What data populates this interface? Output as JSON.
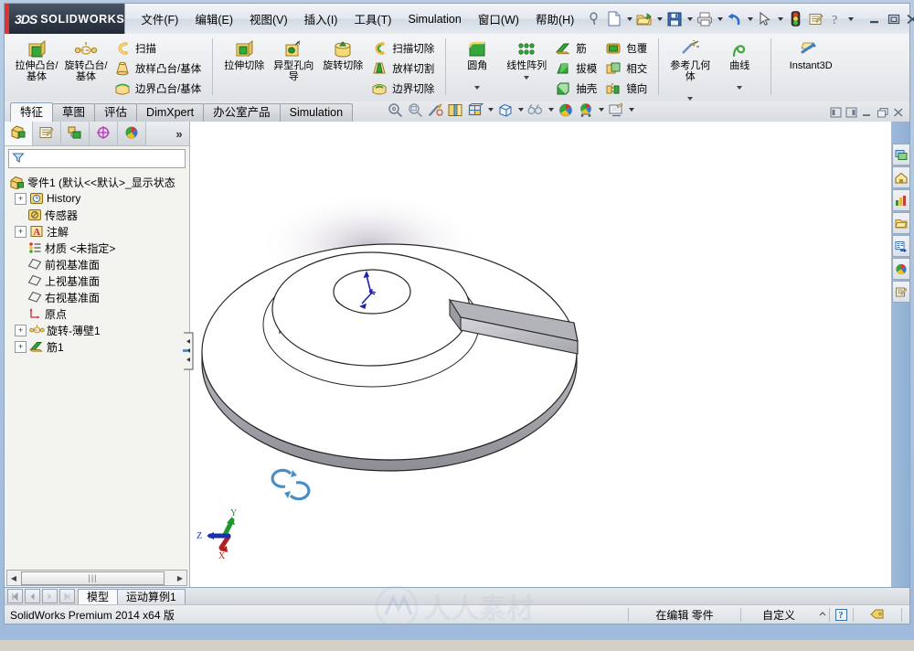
{
  "app": {
    "brand_ds": "3DS",
    "brand_name": "SOLIDWORKS",
    "accent_red": "#d33333",
    "title_dark": "#323c4a"
  },
  "menubar": {
    "items": [
      {
        "label": "文件(F)",
        "name": "menu-file"
      },
      {
        "label": "编辑(E)",
        "name": "menu-edit"
      },
      {
        "label": "视图(V)",
        "name": "menu-view"
      },
      {
        "label": "插入(I)",
        "name": "menu-insert"
      },
      {
        "label": "工具(T)",
        "name": "menu-tools"
      },
      {
        "label": "Simulation",
        "name": "menu-simulation"
      },
      {
        "label": "窗口(W)",
        "name": "menu-window"
      },
      {
        "label": "帮助(H)",
        "name": "menu-help"
      }
    ],
    "icons": [
      "pin-icon",
      "new-document-icon",
      "open-folder-icon",
      "save-icon",
      "print-icon",
      "undo-icon",
      "select-arrow-icon",
      "rebuild-icon",
      "options-icon",
      "help-icon"
    ],
    "window_controls": [
      "minimize",
      "restore",
      "close"
    ]
  },
  "ribbon": {
    "groups": [
      {
        "name": "boss-base-group",
        "big": [
          {
            "label": "拉伸凸台/基体",
            "icon": "extrude-boss-icon",
            "name": "extruded-boss-base"
          },
          {
            "label": "旋转凸台/基体",
            "icon": "revolve-boss-icon",
            "name": "revolved-boss-base"
          }
        ],
        "small": [
          {
            "label": "扫描",
            "icon": "sweep-icon",
            "name": "swept-boss-base"
          },
          {
            "label": "放样凸台/基体",
            "icon": "loft-icon",
            "name": "lofted-boss-base"
          },
          {
            "label": "边界凸台/基体",
            "icon": "boundary-icon",
            "name": "boundary-boss-base"
          }
        ]
      },
      {
        "name": "cut-group",
        "big": [
          {
            "label": "拉伸切除",
            "icon": "extrude-cut-icon",
            "name": "extruded-cut"
          },
          {
            "label": "异型孔向导",
            "icon": "hole-wizard-icon",
            "name": "hole-wizard"
          },
          {
            "label": "旋转切除",
            "icon": "revolve-cut-icon",
            "name": "revolved-cut"
          }
        ],
        "small": [
          {
            "label": "扫描切除",
            "icon": "swept-cut-icon",
            "name": "swept-cut"
          },
          {
            "label": "放样切割",
            "icon": "lofted-cut-icon",
            "name": "lofted-cut"
          },
          {
            "label": "边界切除",
            "icon": "boundary-cut-icon",
            "name": "boundary-cut"
          }
        ]
      },
      {
        "name": "feature-group",
        "big": [
          {
            "label": "圆角",
            "icon": "fillet-icon",
            "name": "fillet",
            "dropdown": true
          },
          {
            "label": "线性阵列",
            "icon": "linear-pattern-icon",
            "name": "linear-pattern",
            "dropdown": true
          }
        ],
        "small": [
          {
            "label": "筋",
            "icon": "rib-icon",
            "name": "rib"
          },
          {
            "label": "拔模",
            "icon": "draft-icon",
            "name": "draft"
          },
          {
            "label": "抽壳",
            "icon": "shell-icon",
            "name": "shell"
          }
        ],
        "small2": [
          {
            "label": "包覆",
            "icon": "wrap-icon",
            "name": "wrap"
          },
          {
            "label": "相交",
            "icon": "intersect-icon",
            "name": "intersect"
          },
          {
            "label": "镜向",
            "icon": "mirror-icon",
            "name": "mirror"
          }
        ]
      },
      {
        "name": "reference-group",
        "big": [
          {
            "label": "参考几何体",
            "icon": "reference-geometry-icon",
            "name": "reference-geometry",
            "dropdown": true
          },
          {
            "label": "曲线",
            "icon": "curves-icon",
            "name": "curves",
            "dropdown": true
          }
        ]
      },
      {
        "name": "instant3d-group",
        "big": [
          {
            "label": "Instant3D",
            "icon": "instant3d-icon",
            "name": "instant3d"
          }
        ]
      }
    ]
  },
  "tabs": {
    "items": [
      {
        "label": "特征",
        "name": "tab-features",
        "active": true
      },
      {
        "label": "草图",
        "name": "tab-sketch",
        "active": false
      },
      {
        "label": "评估",
        "name": "tab-evaluate",
        "active": false
      },
      {
        "label": "DimXpert",
        "name": "tab-dimxpert",
        "active": false
      },
      {
        "label": "办公室产品",
        "name": "tab-office-products",
        "active": false
      },
      {
        "label": "Simulation",
        "name": "tab-simulation",
        "active": false
      }
    ],
    "view_tools": [
      "zoom-to-fit-icon",
      "zoom-to-area-icon",
      "previous-view-icon",
      "section-view-icon",
      "view-orientation-icon",
      "display-style-icon",
      "hide-show-icon",
      "appearances-icon",
      "scene-icon",
      "view-settings-icon"
    ],
    "window_buttons": [
      "tile-left-icon",
      "tile-right-icon",
      "minimize-icon",
      "restore-icon",
      "close-icon"
    ]
  },
  "tree": {
    "tabs": [
      {
        "name": "feature-manager-tab",
        "icon": "feature-tree-icon",
        "active": true
      },
      {
        "name": "property-manager-tab",
        "icon": "property-manager-icon",
        "active": false
      },
      {
        "name": "configuration-manager-tab",
        "icon": "configuration-icon",
        "active": false
      },
      {
        "name": "dimxpert-manager-tab",
        "icon": "dimxpert-icon",
        "active": false
      },
      {
        "name": "display-manager-tab",
        "icon": "display-manager-icon",
        "active": false
      }
    ],
    "more_label": "»",
    "filter_placeholder": "",
    "filter_value": "",
    "root": "零件1  (默认<<默认>_显示状态",
    "items": [
      {
        "label": "History",
        "icon": "history-icon",
        "expandable": true,
        "indent": 1
      },
      {
        "label": "传感器",
        "icon": "sensors-icon",
        "expandable": false,
        "indent": 1
      },
      {
        "label": "注解",
        "icon": "annotations-icon",
        "expandable": true,
        "indent": 1
      },
      {
        "label": "材质 <未指定>",
        "icon": "material-icon",
        "expandable": false,
        "indent": 1
      },
      {
        "label": "前视基准面",
        "icon": "plane-icon",
        "expandable": false,
        "indent": 1
      },
      {
        "label": "上视基准面",
        "icon": "plane-icon",
        "expandable": false,
        "indent": 1
      },
      {
        "label": "右视基准面",
        "icon": "plane-icon",
        "expandable": false,
        "indent": 1
      },
      {
        "label": "原点",
        "icon": "origin-icon",
        "expandable": false,
        "indent": 1
      },
      {
        "label": "旋转-薄壁1",
        "icon": "revolve-thin-icon",
        "expandable": true,
        "indent": 1
      },
      {
        "label": "筋1",
        "icon": "rib-feature-icon",
        "expandable": true,
        "indent": 1
      }
    ],
    "hscroll_grip": "|||"
  },
  "taskpane": {
    "buttons": [
      {
        "name": "solidworks-resources-icon"
      },
      {
        "name": "design-library-icon"
      },
      {
        "name": "file-explorer-icon"
      },
      {
        "name": "search-folder-icon"
      },
      {
        "name": "view-palette-icon"
      },
      {
        "name": "appearances-scenes-icon"
      },
      {
        "name": "custom-properties-icon"
      }
    ]
  },
  "viewport": {
    "triad": {
      "x_label": "X",
      "y_label": "Y",
      "z_label": "Z",
      "x_color": "#b02020",
      "y_color": "#1a9a2a",
      "z_color": "#1a2fb0"
    },
    "origin_marker": "origin-triad-icon",
    "rotate_handle": "rotate-handle-icon",
    "watermark": "人人素材"
  },
  "bottom": {
    "nav_buttons": [
      "first-icon",
      "prev-icon",
      "next-icon",
      "last-icon"
    ],
    "tabs": [
      {
        "label": "模型",
        "name": "bottom-tab-model",
        "active": true
      },
      {
        "label": "运动算例1",
        "name": "bottom-tab-motion-study",
        "active": false
      }
    ]
  },
  "status": {
    "version": "SolidWorks Premium 2014 x64 版",
    "edit_state": "在编辑 零件",
    "custom": "自定义",
    "help_icon": "help-question-icon",
    "tag_icon": "tag-icon"
  }
}
